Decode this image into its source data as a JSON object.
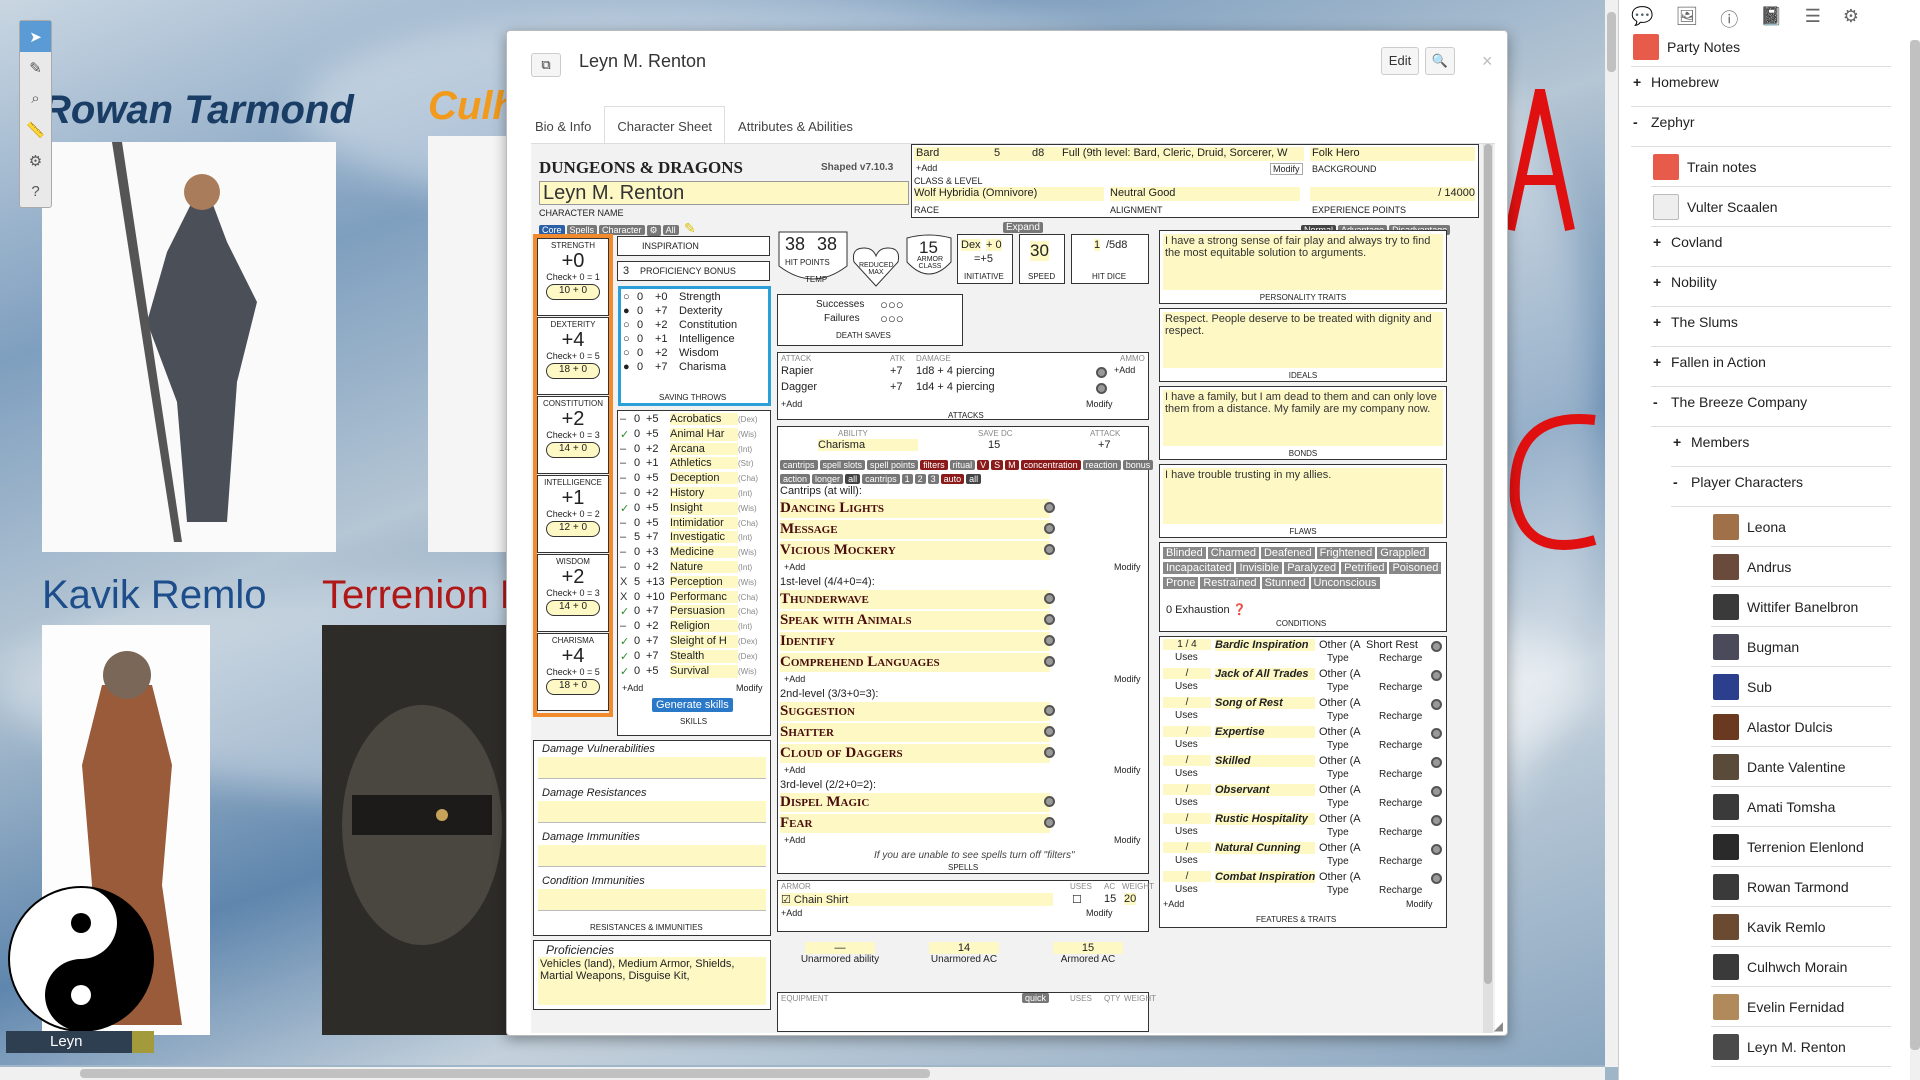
{
  "tokens": {
    "rowan": "Rowan Tarmond",
    "culhwch": "Culhw",
    "kavik": "Kavik Remlo",
    "terrenion": "Terrenion E",
    "leyn": "Leyn"
  },
  "toolbar": {
    "icons": [
      "select-icon",
      "pen-icon",
      "zoom-icon",
      "ruler-icon",
      "fx-icon",
      "help-icon"
    ]
  },
  "dialog": {
    "title": "Leyn M. Renton",
    "edit": "Edit",
    "tabs": [
      "Bio & Info",
      "Character Sheet",
      "Attributes & Abilities"
    ]
  },
  "header": {
    "logo": "DUNGEONS & DRAGONS",
    "version": "Shaped v7.10.3",
    "class": "Bard",
    "level": "5",
    "hd": "d8",
    "caster": "Full (9th level: Bard, Cleric, Druid, Sorcerer, W",
    "background": "Folk Hero",
    "add": "+Add",
    "modify": "Modify",
    "bg_label": "BACKGROUND",
    "cl_label": "CLASS & LEVEL",
    "race": "Wolf Hybridia (Omnivore)",
    "alignment": "Neutral Good",
    "xp": "/ 14000",
    "race_label": "RACE",
    "align_label": "ALIGNMENT",
    "xp_label": "EXPERIENCE POINTS",
    "char_label": "CHARACTER NAME",
    "name": "Leyn M. Renton",
    "tabs": [
      "Core",
      "Spells",
      "Character",
      "All"
    ],
    "expand": "Expand",
    "adv": [
      "Normal",
      "Advantage",
      "Disadvantage"
    ]
  },
  "abilities": [
    {
      "name": "STRENGTH",
      "mod": "+0",
      "check": "Check+ 0 = 1",
      "score": "10 + 0"
    },
    {
      "name": "DEXTERITY",
      "mod": "+4",
      "check": "Check+ 0 = 5",
      "score": "18 + 0"
    },
    {
      "name": "CONSTITUTION",
      "mod": "+2",
      "check": "Check+ 0 = 3",
      "score": "14 + 0"
    },
    {
      "name": "INTELLIGENCE",
      "mod": "+1",
      "check": "Check+ 0 = 2",
      "score": "12 + 0"
    },
    {
      "name": "WISDOM",
      "mod": "+2",
      "check": "Check+ 0 = 3",
      "score": "14 + 0"
    },
    {
      "name": "CHARISMA",
      "mod": "+4",
      "check": "Check+ 0 = 5",
      "score": "18 + 0"
    }
  ],
  "insp": "INSPIRATION",
  "prof": "3",
  "prof_label": "PROFICIENCY BONUS",
  "saves": [
    [
      "0",
      "+0",
      "Strength"
    ],
    [
      "0",
      "+7",
      "Dexterity"
    ],
    [
      "0",
      "+2",
      "Constitution"
    ],
    [
      "0",
      "+1",
      "Intelligence"
    ],
    [
      "0",
      "+2",
      "Wisdom"
    ],
    [
      "0",
      "+7",
      "Charisma"
    ]
  ],
  "saves_label": "SAVING THROWS",
  "skills": [
    [
      "–",
      "0",
      "+5",
      "Acrobatics",
      "(Dex)"
    ],
    [
      "✓",
      "0",
      "+5",
      "Animal Har",
      "(Wis)"
    ],
    [
      "–",
      "0",
      "+2",
      "Arcana",
      "(Int)"
    ],
    [
      "–",
      "0",
      "+1",
      "Athletics",
      "(Str)"
    ],
    [
      "–",
      "0",
      "+5",
      "Deception",
      "(Cha)"
    ],
    [
      "–",
      "0",
      "+2",
      "History",
      "(Int)"
    ],
    [
      "✓",
      "0",
      "+5",
      "Insight",
      "(Wis)"
    ],
    [
      "–",
      "0",
      "+5",
      "Intimidatior",
      "(Cha)"
    ],
    [
      "–",
      "5",
      "+7",
      "Investigatic",
      "(Int)"
    ],
    [
      "–",
      "0",
      "+3",
      "Medicine",
      "(Wis)"
    ],
    [
      "–",
      "0",
      "+2",
      "Nature",
      "(Int)"
    ],
    [
      "X",
      "5",
      "+13",
      "Perception",
      "(Wis)"
    ],
    [
      "X",
      "0",
      "+10",
      "Performanc",
      "(Cha)"
    ],
    [
      "✓",
      "0",
      "+7",
      "Persuasion",
      "(Cha)"
    ],
    [
      "–",
      "0",
      "+2",
      "Religion",
      "(Int)"
    ],
    [
      "✓",
      "0",
      "+7",
      "Sleight of H",
      "(Dex)"
    ],
    [
      "✓",
      "0",
      "+7",
      "Stealth",
      "(Dex)"
    ],
    [
      "✓",
      "0",
      "+5",
      "Survival",
      "(Wis)"
    ]
  ],
  "skills_add": "+Add",
  "skills_mod": "Modify",
  "gen_skills": "Generate skills",
  "skills_label": "SKILLS",
  "hp": {
    "cur": "38",
    "max": "38",
    "label": "HIT POINTS",
    "temp": "TEMP",
    "reduced": "REDUCED MAX"
  },
  "ac": {
    "val": "15",
    "label": "ARMOR CLASS"
  },
  "init": {
    "a": "Dex",
    "b": "+ 0",
    "c": "=+5",
    "label": "INITIATIVE"
  },
  "speed": {
    "val": "30",
    "label": "SPEED"
  },
  "hd": {
    "val": "1",
    "max": "/5d8",
    "label": "HIT DICE"
  },
  "death": {
    "s": "Successes",
    "f": "Failures",
    "label": "DEATH SAVES"
  },
  "attacks": {
    "hdr": [
      "ATTACK",
      "ATK",
      "DAMAGE",
      "AMMO"
    ],
    "rows": [
      [
        "Rapier",
        "+7",
        "1d8 + 4 piercing"
      ],
      [
        "Dagger",
        "+7",
        "1d4 + 4 piercing"
      ]
    ],
    "label": "ATTACKS"
  },
  "spellcasting": {
    "ab_label": "ABILITY",
    "ability": "Charisma",
    "dc_label": "SAVE DC",
    "dc": "15",
    "atk_label": "ATTACK",
    "atk": "+7"
  },
  "spell_tags1": [
    "cantrips",
    "spell slots",
    "spell points",
    "filters",
    "ritual",
    "V",
    "S",
    "M",
    "concentration",
    "reaction",
    "bonus"
  ],
  "spell_tags2": [
    "action",
    "longer",
    "all",
    "cantrips",
    "1",
    "2",
    "3",
    "auto",
    "all"
  ],
  "spell_levels": [
    {
      "title": "Cantrips (at will):",
      "spells": [
        "Dancing Lights",
        "Message",
        "Vicious Mockery"
      ]
    },
    {
      "title": "1st-level (4/4+0=4):",
      "spells": [
        "Thunderwave",
        "Speak with Animals",
        "Identify",
        "Comprehend Languages"
      ]
    },
    {
      "title": "2nd-level (3/3+0=3):",
      "spells": [
        "Suggestion",
        "Shatter",
        "Cloud of Daggers"
      ]
    },
    {
      "title": "3rd-level (2/2+0=2):",
      "spells": [
        "Dispel Magic",
        "Fear"
      ]
    }
  ],
  "spell_note": "If you are unable to see spells turn off \"filters\"",
  "spells_label": "SPELLS",
  "armor": {
    "label": "ARMOR",
    "uses": "USES",
    "ac": "AC",
    "weight": "WEIGHT",
    "name": "Chain Shirt",
    "acv": "15",
    "w": "20"
  },
  "unarmored": [
    [
      "—",
      "Unarmored ability"
    ],
    [
      "14",
      "Unarmored AC"
    ],
    [
      "15",
      "Armored AC"
    ]
  ],
  "equip": {
    "label": "EQUIPMENT",
    "quick": "quick",
    "uses": "USES",
    "qty": "QTY",
    "weight": "WEIGHT"
  },
  "traits": [
    {
      "text": "I have a strong sense of fair play and always try to find the most equitable solution to arguments.",
      "label": "PERSONALITY TRAITS"
    },
    {
      "text": "Respect. People deserve to be treated with dignity and respect.",
      "label": "IDEALS"
    },
    {
      "text": "I have a family, but I am dead to them and can only love them from a distance. My family are my company now.",
      "label": "BONDS"
    },
    {
      "text": "I have trouble trusting in my allies.",
      "label": "FLAWS"
    }
  ],
  "conditions": [
    "Blinded",
    "Charmed",
    "Deafened",
    "Frightened",
    "Grappled",
    "Incapacitated",
    "Invisible",
    "Paralyzed",
    "Petrified",
    "Poisoned",
    "Prone",
    "Restrained",
    "Stunned",
    "Unconscious"
  ],
  "exhaustion": "0  Exhaustion",
  "cond_label": "CONDITIONS",
  "features": [
    {
      "uses": "1  /  4",
      "name": "Bardic Inspiration",
      "type": "Other (A",
      "rech": "Short Rest"
    },
    {
      "uses": "/",
      "name": "Jack of All Trades",
      "type": "Other (A",
      "rech": "Recharge"
    },
    {
      "uses": "/",
      "name": "Song of Rest",
      "type": "Other (A",
      "rech": "Recharge"
    },
    {
      "uses": "/",
      "name": "Expertise",
      "type": "Other (A",
      "rech": "Recharge"
    },
    {
      "uses": "/",
      "name": "Skilled",
      "type": "Other (A",
      "rech": "Recharge"
    },
    {
      "uses": "/",
      "name": "Observant",
      "type": "Other (A",
      "rech": "Recharge"
    },
    {
      "uses": "/",
      "name": "Rustic Hospitality",
      "type": "Other (A",
      "rech": "Recharge"
    },
    {
      "uses": "/",
      "name": "Natural Cunning",
      "type": "Other (A",
      "rech": "Recharge"
    },
    {
      "uses": "/",
      "name": "Combat Inspiration",
      "type": "Other (A",
      "rech": "Recharge"
    }
  ],
  "feat_label": "FEATURES & TRAITS",
  "uses_word": "Uses",
  "type_word": "Type",
  "resist": [
    "Damage Vulnerabilities",
    "Damage Resistances",
    "Damage Immunities",
    "Condition Immunities"
  ],
  "resist_label": "RESISTANCES & IMMUNITIES",
  "profs": {
    "title": "Proficiencies",
    "text": "Vehicles (land), Medium Armor, Shields, Martial Weapons, Disguise Kit,"
  },
  "sidebar": {
    "items": [
      {
        "label": "Party Notes",
        "kind": "handout"
      },
      {
        "label": "Homebrew",
        "kind": "folder+"
      },
      {
        "label": "Zephyr",
        "kind": "folder-"
      },
      {
        "label": "Train notes",
        "kind": "handout"
      },
      {
        "label": "Vulter Scaalen",
        "kind": "img"
      },
      {
        "label": "Covland",
        "kind": "folder+"
      },
      {
        "label": "Nobility",
        "kind": "folder+"
      },
      {
        "label": "The Slums",
        "kind": "folder+"
      },
      {
        "label": "Fallen in Action",
        "kind": "folder+"
      },
      {
        "label": "The Breeze Company",
        "kind": "folder-"
      },
      {
        "label": "Members",
        "kind": "folder+"
      },
      {
        "label": "Player Characters",
        "kind": "folder-"
      },
      {
        "label": "Leona",
        "kind": "char"
      },
      {
        "label": "Andrus",
        "kind": "char"
      },
      {
        "label": "Wittifer Banelbron",
        "kind": "char"
      },
      {
        "label": "Bugman",
        "kind": "char"
      },
      {
        "label": "Sub",
        "kind": "char"
      },
      {
        "label": "Alastor Dulcis",
        "kind": "char"
      },
      {
        "label": "Dante Valentine",
        "kind": "char"
      },
      {
        "label": "Amati Tomsha",
        "kind": "char"
      },
      {
        "label": "Terrenion Elenlond",
        "kind": "char"
      },
      {
        "label": "Rowan Tarmond",
        "kind": "char"
      },
      {
        "label": "Kavik Remlo",
        "kind": "char"
      },
      {
        "label": "Culhwch Morain",
        "kind": "char"
      },
      {
        "label": "Evelin Fernidad",
        "kind": "char"
      },
      {
        "label": "Leyn M. Renton",
        "kind": "char"
      }
    ]
  }
}
